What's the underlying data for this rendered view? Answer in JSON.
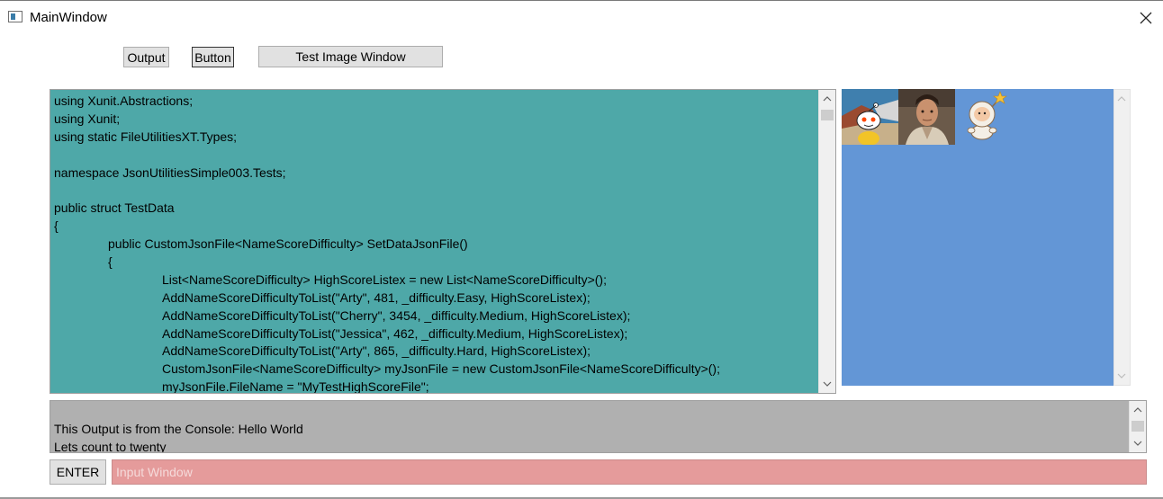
{
  "window": {
    "title": "MainWindow"
  },
  "toolbar": {
    "output_label": "Output",
    "button_label": "Button",
    "test_image_label": "Test Image Window"
  },
  "code_view": {
    "background": "#4ea8a8",
    "lines": [
      "using Xunit.Abstractions;",
      "using Xunit;",
      "using static FileUtilitiesXT.Types;",
      "",
      "namespace JsonUtilitiesSimple003.Tests;",
      "",
      "public struct TestData",
      "{",
      "public CustomJsonFile<NameScoreDifficulty> SetDataJsonFile()",
      "{",
      "List<NameScoreDifficulty> HighScoreListex = new List<NameScoreDifficulty>();",
      "AddNameScoreDifficultyToList(\"Arty\", 481, _difficulty.Easy, HighScoreListex);",
      "AddNameScoreDifficultyToList(\"Cherry\", 3454, _difficulty.Medium, HighScoreListex);",
      "AddNameScoreDifficultyToList(\"Jessica\", 462, _difficulty.Medium, HighScoreListex);",
      "AddNameScoreDifficultyToList(\"Arty\", 865, _difficulty.Hard, HighScoreListex);",
      "CustomJsonFile<NameScoreDifficulty> myJsonFile = new CustomJsonFile<NameScoreDifficulty>();",
      "myJsonFile.FileName = \"MyTestHighScoreFile\";"
    ]
  },
  "image_panel": {
    "background": "#6396d6",
    "thumbnails": [
      "reddit-alien-icon",
      "portrait-photo",
      "astronaut-icon"
    ]
  },
  "output_panel": {
    "background": "#b0b0b0",
    "lines": [
      "This Output is from the Console: Hello World",
      "Lets count to twenty"
    ]
  },
  "input_bar": {
    "enter_label": "ENTER",
    "placeholder": "Input Window",
    "value": ""
  }
}
